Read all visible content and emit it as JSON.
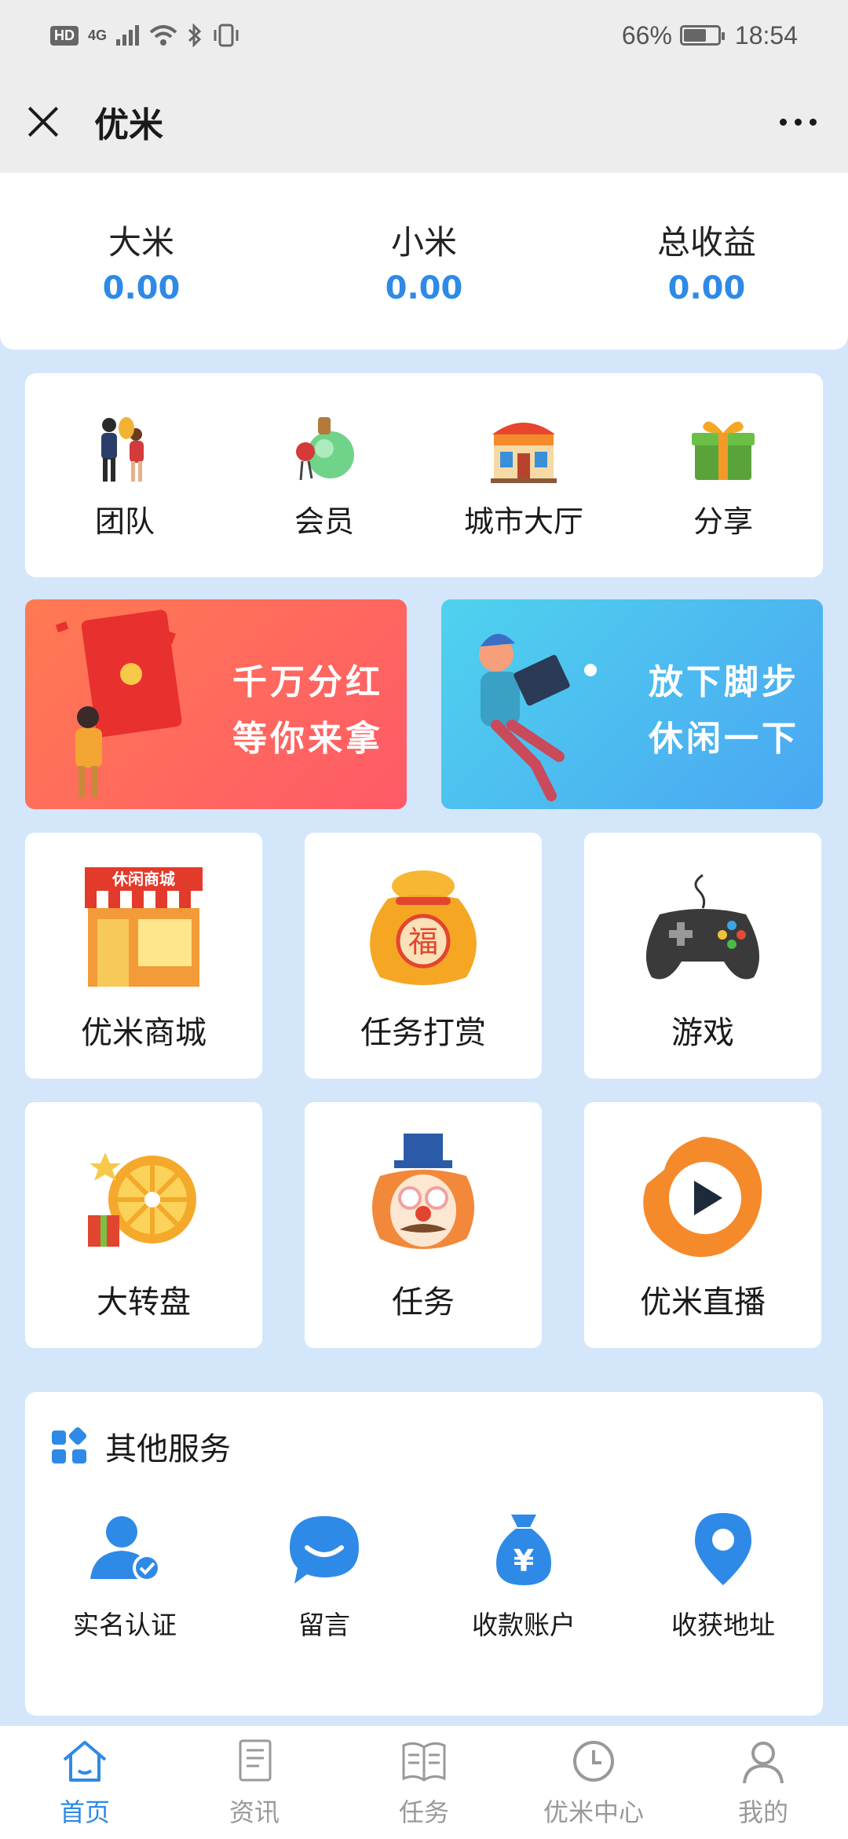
{
  "status_bar": {
    "network": "HD",
    "signal": "4G",
    "battery": "66%",
    "battery_level": 0.66,
    "time": "18:54"
  },
  "title_bar": {
    "title": "优米"
  },
  "stats": [
    {
      "label": "大米",
      "value": "0.00"
    },
    {
      "label": "小米",
      "value": "0.00"
    },
    {
      "label": "总收益",
      "value": "0.00"
    }
  ],
  "quick_menu": [
    {
      "label": "团队",
      "icon": "team-icon"
    },
    {
      "label": "会员",
      "icon": "member-icon"
    },
    {
      "label": "城市大厅",
      "icon": "city-hall-icon"
    },
    {
      "label": "分享",
      "icon": "share-gift-icon"
    }
  ],
  "banners": [
    {
      "line1": "千万分红",
      "line2": "等你来拿"
    },
    {
      "line1": "放下脚步",
      "line2": "休闲一下"
    }
  ],
  "tiles": [
    {
      "label": "优米商城"
    },
    {
      "label": "任务打赏"
    },
    {
      "label": "游戏"
    },
    {
      "label": "大转盘"
    },
    {
      "label": "任务"
    },
    {
      "label": "优米直播"
    }
  ],
  "shop_sign": "休闲商城",
  "services": {
    "title": "其他服务",
    "items": [
      {
        "label": "实名认证"
      },
      {
        "label": "留言"
      },
      {
        "label": "收款账户"
      },
      {
        "label": "收获地址"
      }
    ]
  },
  "tabs": [
    {
      "label": "首页",
      "active": true
    },
    {
      "label": "资讯"
    },
    {
      "label": "任务"
    },
    {
      "label": "优米中心"
    },
    {
      "label": "我的"
    }
  ],
  "colors": {
    "accent": "#2e8ae6",
    "background": "#d4e6fa"
  }
}
